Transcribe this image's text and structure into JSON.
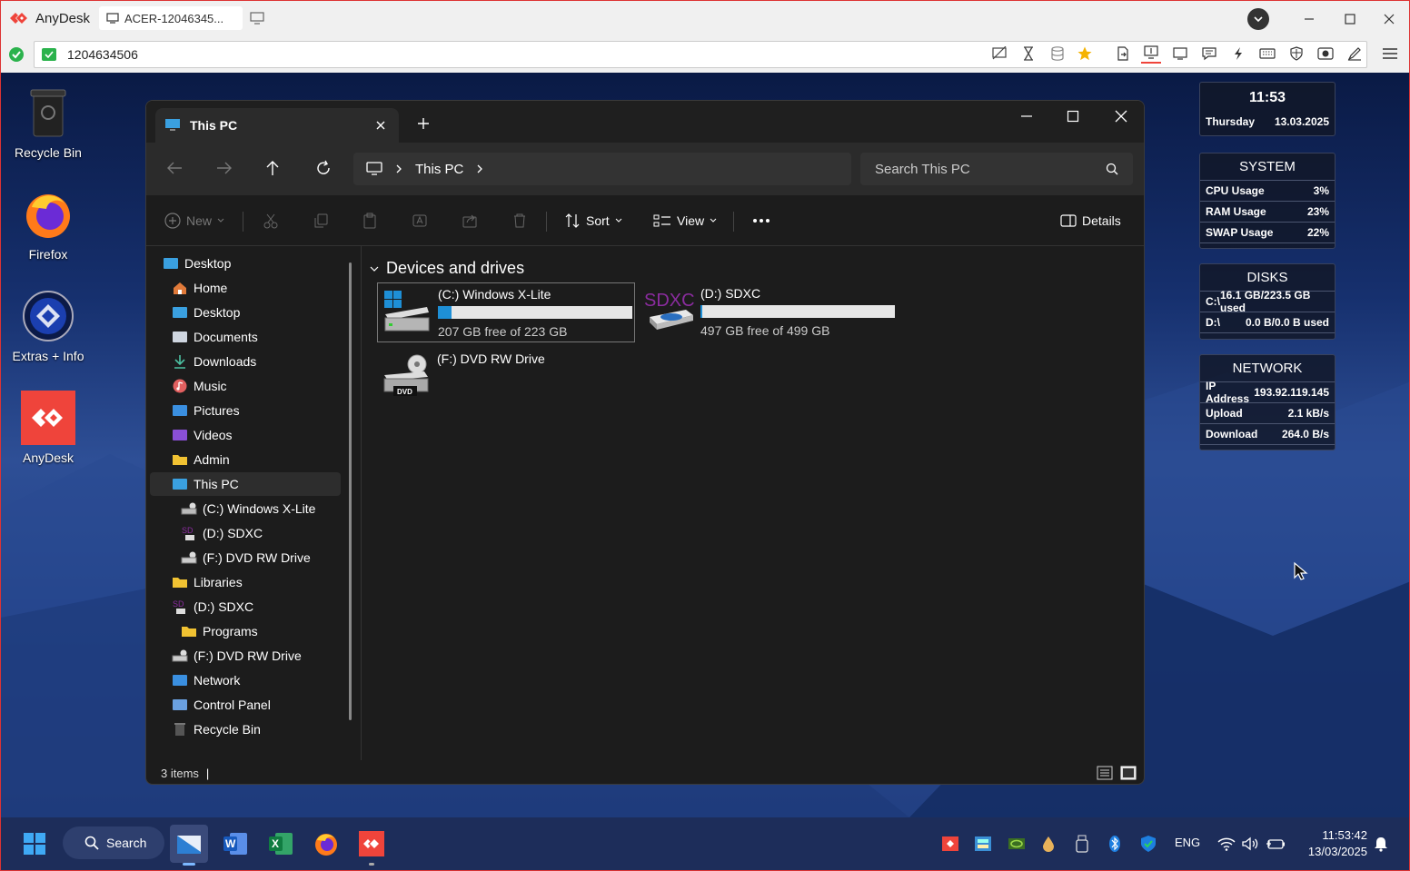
{
  "anydesk": {
    "app_name": "AnyDesk",
    "tab_title": "ACER-12046345...",
    "address": "1204634506",
    "colors": {
      "brand": "#ef443b",
      "ok": "#2bb24c"
    }
  },
  "desktop": {
    "icons": [
      {
        "label": "Recycle Bin",
        "icon": "recycle-bin-icon"
      },
      {
        "label": "Firefox",
        "icon": "firefox-icon"
      },
      {
        "label": "Extras + Info",
        "icon": "extras-info-icon"
      },
      {
        "label": "AnyDesk",
        "icon": "anydesk-icon"
      }
    ]
  },
  "explorer": {
    "tab_title": "This PC",
    "breadcrumb": [
      "This PC"
    ],
    "search_placeholder": "Search This PC",
    "toolbar": {
      "new": "New",
      "sort": "Sort",
      "view": "View",
      "details": "Details"
    },
    "sidebar": [
      {
        "label": "Desktop",
        "icon": "desktop-folder-icon"
      },
      {
        "label": "Home",
        "icon": "home-icon"
      },
      {
        "label": "Desktop",
        "icon": "desktop-folder-icon"
      },
      {
        "label": "Documents",
        "icon": "documents-icon"
      },
      {
        "label": "Downloads",
        "icon": "downloads-icon"
      },
      {
        "label": "Music",
        "icon": "music-icon"
      },
      {
        "label": "Pictures",
        "icon": "pictures-icon"
      },
      {
        "label": "Videos",
        "icon": "videos-icon"
      },
      {
        "label": "Admin",
        "icon": "folder-icon"
      },
      {
        "label": "This PC",
        "icon": "this-pc-icon"
      },
      {
        "label": "(C:) Windows X-Lite",
        "icon": "drive-c-icon"
      },
      {
        "label": "(D:) SDXC",
        "icon": "sdxc-icon"
      },
      {
        "label": "(F:) DVD RW Drive",
        "icon": "dvd-drive-icon"
      },
      {
        "label": "Libraries",
        "icon": "folder-icon"
      },
      {
        "label": "(D:) SDXC",
        "icon": "sdxc-icon"
      },
      {
        "label": "Programs",
        "icon": "folder-icon"
      },
      {
        "label": "(F:) DVD RW Drive",
        "icon": "dvd-drive-icon"
      },
      {
        "label": "Network",
        "icon": "network-icon"
      },
      {
        "label": "Control Panel",
        "icon": "control-panel-icon"
      },
      {
        "label": "Recycle Bin",
        "icon": "recycle-bin-icon"
      }
    ],
    "section_title": "Devices and drives",
    "drives": [
      {
        "name": "(C:) Windows X-Lite",
        "free": "207 GB free of 223 GB",
        "used_fraction": 0.07
      },
      {
        "name": "(D:) SDXC",
        "free": "497 GB free of 499 GB",
        "used_fraction": 0.004
      },
      {
        "name": "(F:) DVD RW Drive",
        "badge": "DVD"
      }
    ],
    "sd_logo_text": "SDXC",
    "status": "3 items"
  },
  "widgets": {
    "clock": {
      "time": "11:53",
      "day": "Thursday",
      "date": "13.03.2025"
    },
    "system": {
      "title": "SYSTEM",
      "rows": [
        {
          "label": "CPU Usage",
          "value": "3%"
        },
        {
          "label": "RAM Usage",
          "value": "23%"
        },
        {
          "label": "SWAP Usage",
          "value": "22%"
        }
      ]
    },
    "disks": {
      "title": "DISKS",
      "rows": [
        {
          "label": "C:\\",
          "value": "16.1 GB/223.5 GB used"
        },
        {
          "label": "D:\\",
          "value": "0.0 B/0.0 B used"
        }
      ]
    },
    "network": {
      "title": "NETWORK",
      "rows": [
        {
          "label": "IP Address",
          "value": "193.92.119.145"
        },
        {
          "label": "Upload",
          "value": "2.1 kB/s"
        },
        {
          "label": "Download",
          "value": "264.0 B/s"
        }
      ]
    }
  },
  "taskbar": {
    "search_label": "Search",
    "lang": "ENG",
    "time": "11:53:42",
    "date": "13/03/2025"
  }
}
